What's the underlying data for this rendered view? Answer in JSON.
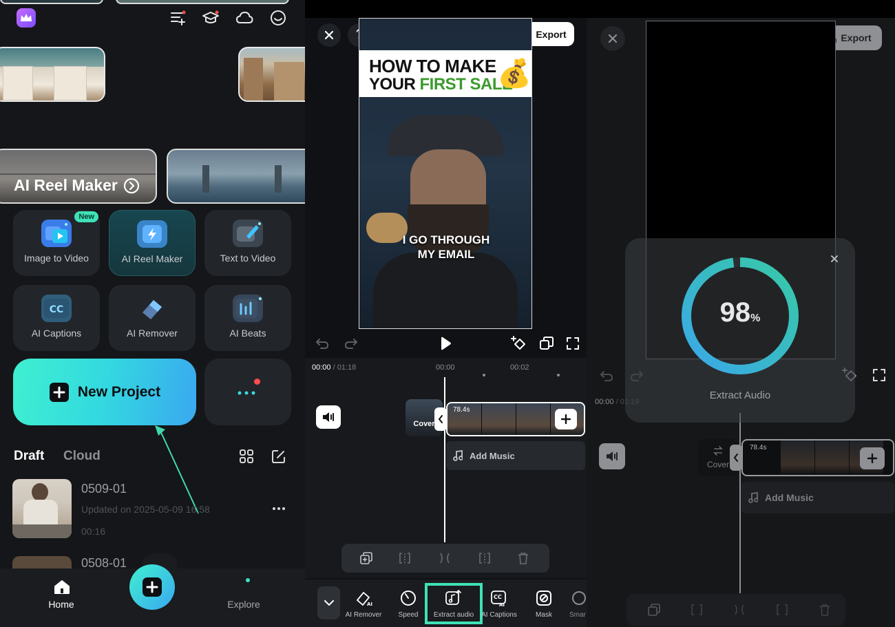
{
  "home": {
    "reel_maker_label": "AI Reel Maker",
    "tools": [
      {
        "label": "Image to Video",
        "badge": "New"
      },
      {
        "label": "AI Reel Maker"
      },
      {
        "label": "Text to Video"
      },
      {
        "label": "AI Captions"
      },
      {
        "label": "AI Remover"
      },
      {
        "label": "AI Beats"
      }
    ],
    "new_project_label": "New Project",
    "tabs": {
      "draft": "Draft",
      "cloud": "Cloud"
    },
    "projects": [
      {
        "name": "0509-01",
        "updated": "Updated on 2025-05-09 16:58",
        "duration": "00:16"
      },
      {
        "name": "0508-01"
      }
    ],
    "bottom_nav": {
      "home": "Home",
      "explore": "Explore"
    },
    "accent": "#3fe2c9"
  },
  "editor": {
    "export_label": "Export",
    "video_title_line1": "HOW TO MAKE",
    "video_title_line2a": "YOUR ",
    "video_title_line2b": "FIRST SALE",
    "video_emoji": "💰",
    "video_caption_line1": "I GO THROUGH",
    "video_caption_line2": "MY EMAIL",
    "time_current": "00:00",
    "time_total": " / 01:18",
    "ruler_marks": [
      "00:00",
      "00:02"
    ],
    "cover_label": "Cover",
    "clip_duration": "78.4s",
    "add_music_label": "Add Music",
    "toolbar": [
      {
        "label": "AI Remover"
      },
      {
        "label": "Speed"
      },
      {
        "label": "Extract audio",
        "highlight": true
      },
      {
        "label": "AI Captions"
      },
      {
        "label": "Mask"
      },
      {
        "label": "Smar"
      }
    ],
    "highlight_color": "#3fe2b6"
  },
  "extract": {
    "export_label": "Export",
    "progress_value": "98",
    "progress_unit": "%",
    "progress_fraction": 0.98,
    "dialog_label": "Extract Audio",
    "time_current": "00:00",
    "time_total": " / 01:19",
    "cover_label": "Cover",
    "clip_duration": "78.4s",
    "add_music_label": "Add Music"
  }
}
